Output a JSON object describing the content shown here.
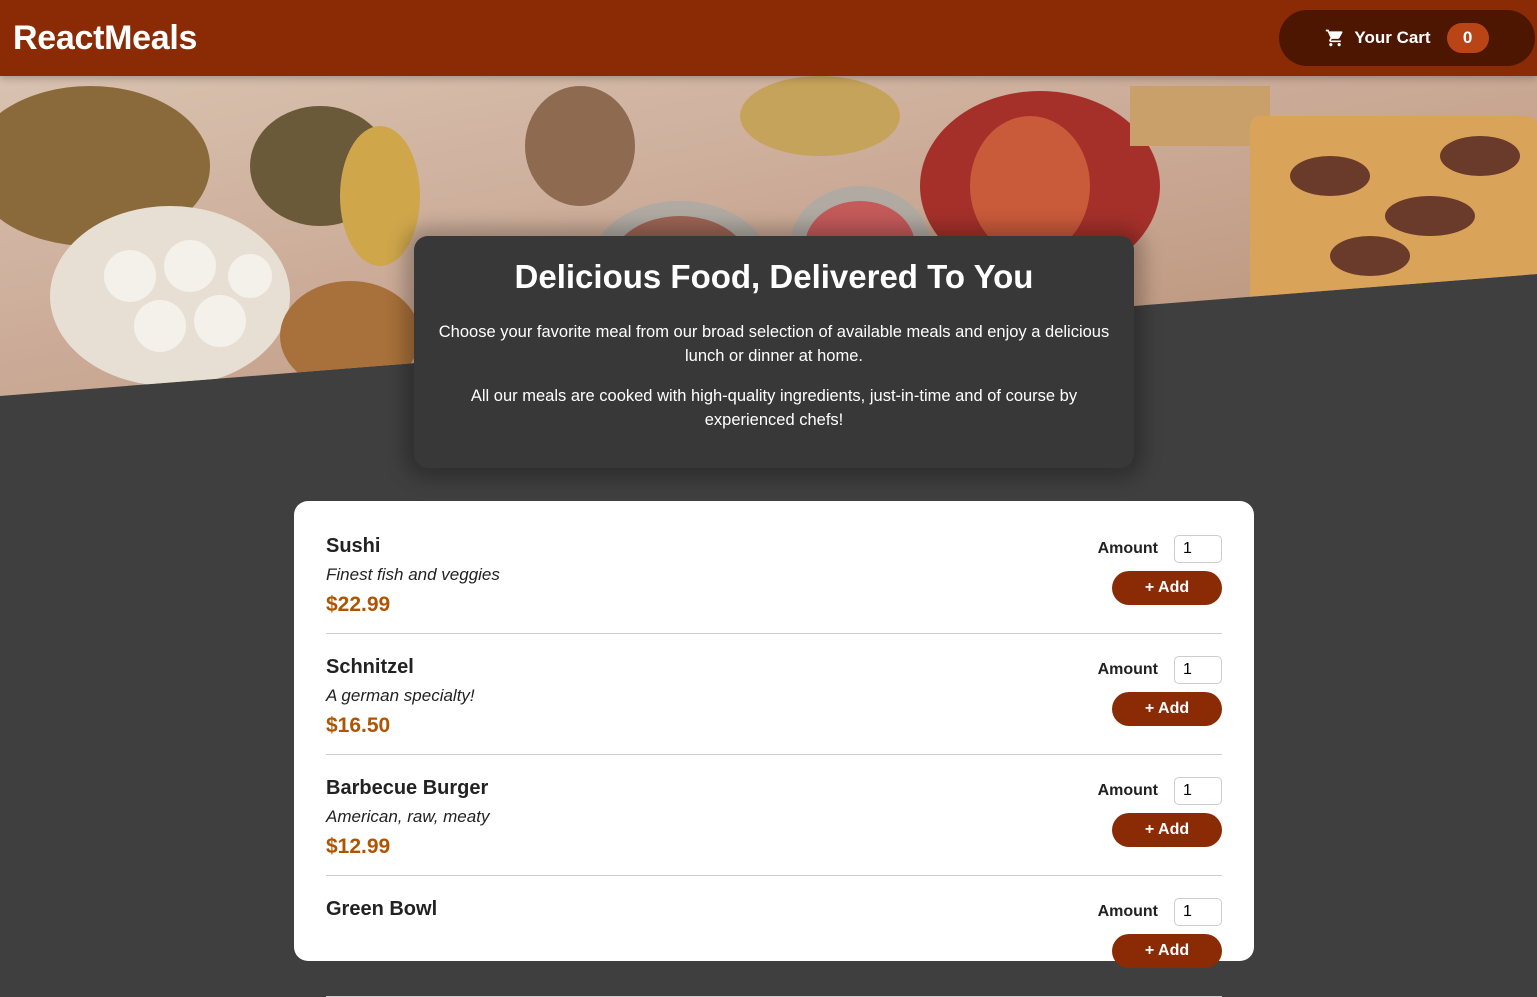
{
  "header": {
    "brand": "ReactMeals",
    "cart_label": "Your Cart",
    "cart_count": "0",
    "cart_icon": "shopping-cart-icon"
  },
  "summary": {
    "title": "Delicious Food, Delivered To You",
    "paragraph1": "Choose your favorite meal from our broad selection of available meals and enjoy a delicious lunch or dinner at home.",
    "paragraph2": "All our meals are cooked with high-quality ingredients, just-in-time and of course by experienced chefs!"
  },
  "meals": {
    "amount_label": "Amount",
    "add_label": "+ Add",
    "items": [
      {
        "name": "Sushi",
        "description": "Finest fish and veggies",
        "price": "$22.99",
        "amount": "1"
      },
      {
        "name": "Schnitzel",
        "description": "A german specialty!",
        "price": "$16.50",
        "amount": "1"
      },
      {
        "name": "Barbecue Burger",
        "description": "American, raw, meaty",
        "price": "$12.99",
        "amount": "1"
      },
      {
        "name": "Green Bowl",
        "description": "",
        "price": "",
        "amount": "1"
      }
    ]
  },
  "colors": {
    "header": "#8a2b06",
    "cart_button": "#4d1601",
    "badge": "#b94517",
    "background": "#3f3f3f",
    "price": "#ad5502"
  }
}
